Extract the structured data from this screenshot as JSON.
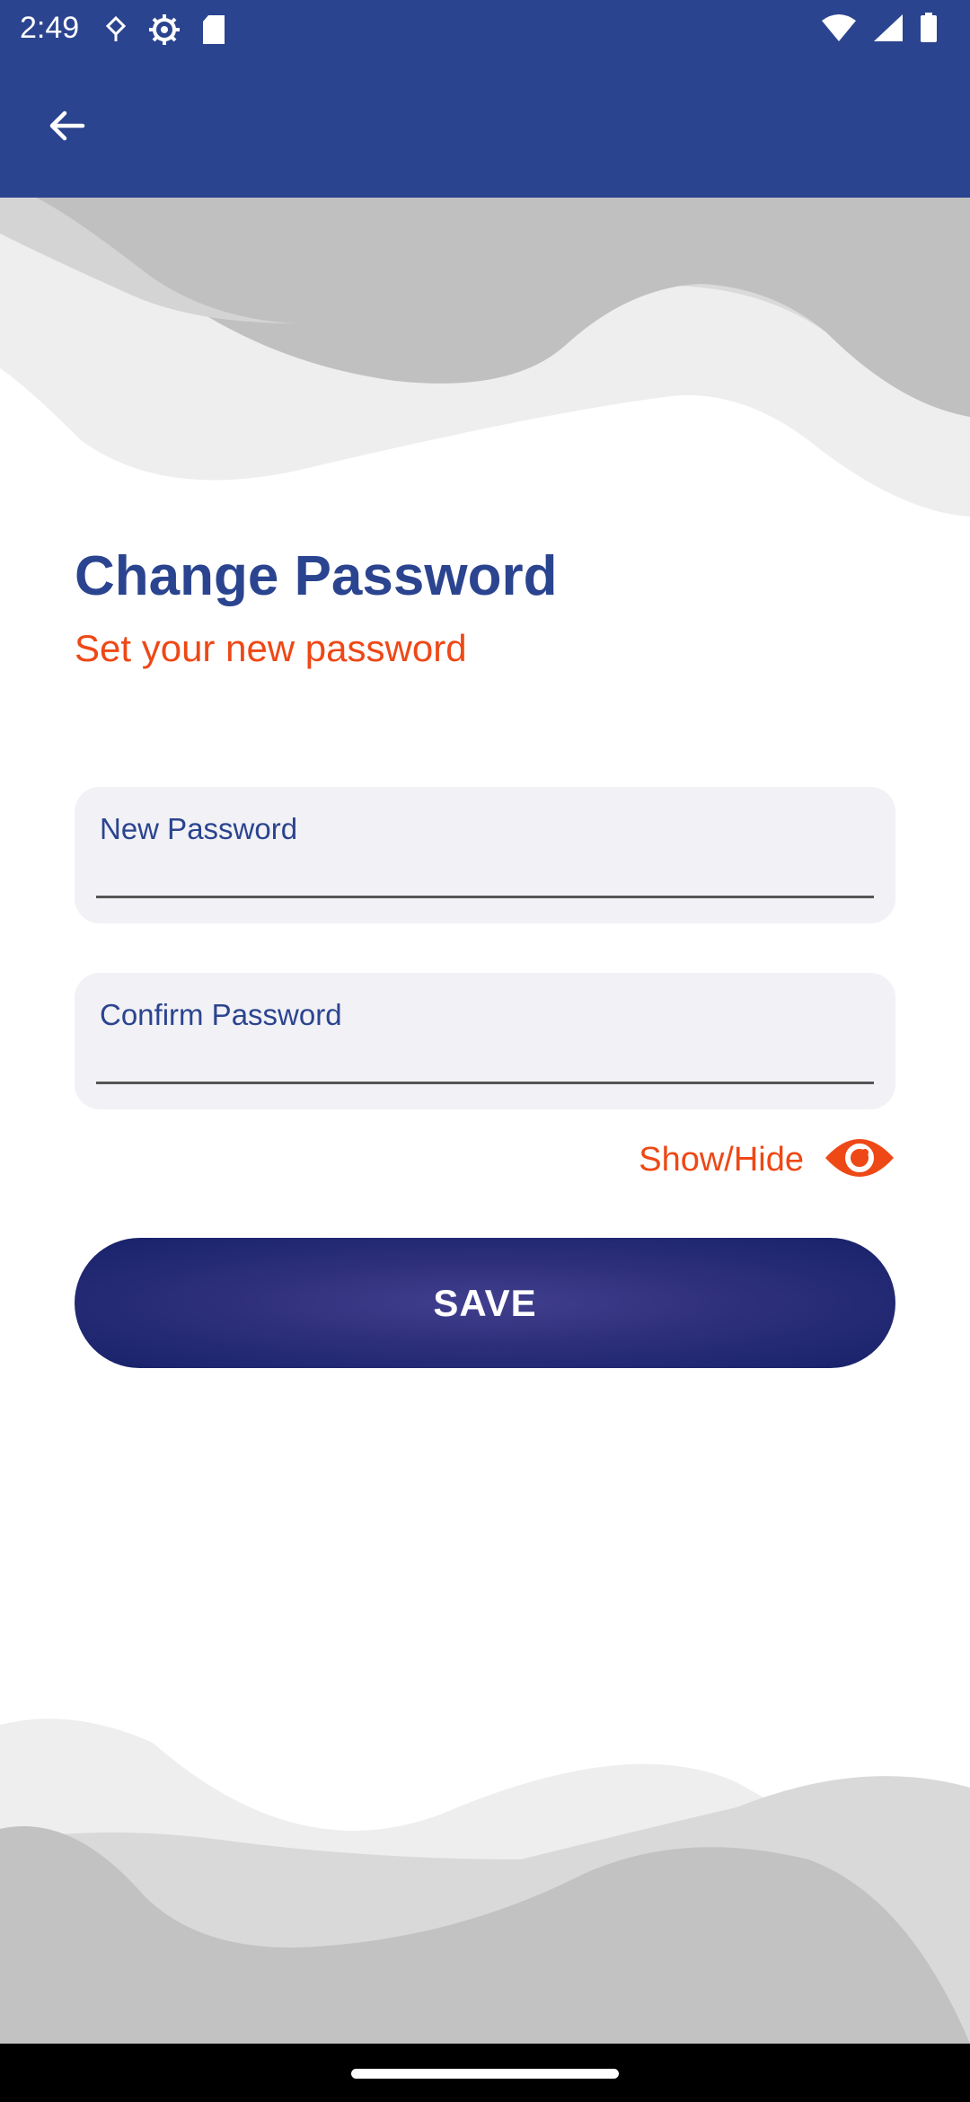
{
  "status_bar": {
    "time": "2:49",
    "left_icons": [
      "navigation-icon",
      "settings-icon",
      "sd-card-icon"
    ],
    "right_icons": [
      "wifi-icon",
      "signal-icon",
      "battery-icon"
    ]
  },
  "app_bar": {
    "back_icon": "arrow-left-icon"
  },
  "header": {
    "title": "Change Password",
    "subtitle": "Set your new password"
  },
  "form": {
    "new_password": {
      "label": "New Password",
      "value": ""
    },
    "confirm_password": {
      "label": "Confirm Password",
      "value": ""
    },
    "show_hide": {
      "label": "Show/Hide",
      "icon": "eye-icon"
    },
    "save_label": "SAVE"
  },
  "colors": {
    "primary": "#2b448f",
    "accent": "#ee4816",
    "field_background": "#f1f1f6",
    "button_dark": "#16226a"
  }
}
